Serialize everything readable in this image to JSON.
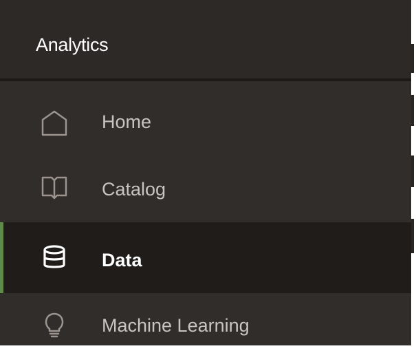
{
  "app": {
    "title": "Analytics"
  },
  "nav": {
    "items": [
      {
        "label": "Home",
        "icon": "home-icon",
        "active": false
      },
      {
        "label": "Catalog",
        "icon": "book-icon",
        "active": false
      },
      {
        "label": "Data",
        "icon": "database-icon",
        "active": true
      },
      {
        "label": "Machine Learning",
        "icon": "lightbulb-icon",
        "active": false
      }
    ]
  },
  "colors": {
    "panel_bg": "#312d2a",
    "header_bg": "#2d2926",
    "active_bg": "#1f1c1a",
    "active_indicator": "#5f8a4a",
    "text_inactive": "#c9c4bf",
    "text_active": "#ffffff"
  }
}
